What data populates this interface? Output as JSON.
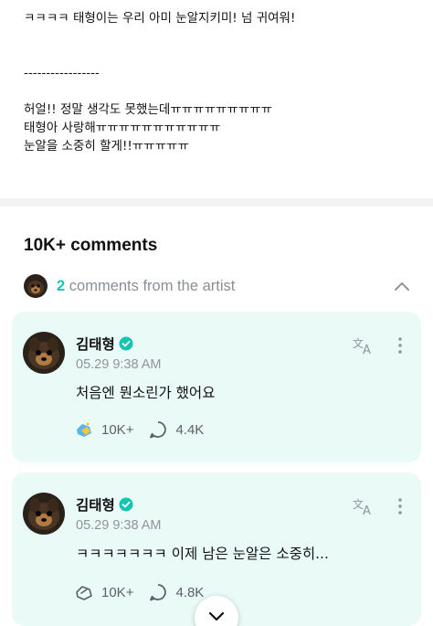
{
  "post": {
    "line1": "ㅋㅋㅋㅋ 태형이는 우리 아미 눈알지키미! 넘 귀여워!",
    "divider": "-----------------",
    "line2": "허얼!! 정말 생각도 못했는데ㅠㅠㅠㅠㅠㅠㅠㅠㅠ",
    "line3": "태형아 사랑해ㅠㅠㅠㅠㅠㅠㅠㅠㅠㅠㅠ",
    "line4": "눈알을 소중히 할게!!ㅠㅠㅠㅠㅠ"
  },
  "comments_header": {
    "count": "10K+ comments",
    "artist_count": "2",
    "artist_label": "comments from the artist"
  },
  "comments": [
    {
      "author": "김태형",
      "time": "05.29 9:38 AM",
      "text": "처음엔 뭔소린가 했어요",
      "likes": "10K+",
      "replies": "4.4K",
      "liked": true
    },
    {
      "author": "김태형",
      "time": "05.29 9:38 AM",
      "text": "ㅋㅋㅋㅋㅋㅋㅋ 이제 남은 눈알은 소중히...",
      "likes": "10K+",
      "replies": "4.8K",
      "liked": false
    }
  ],
  "colors": {
    "accent": "#17c3b2",
    "card_bg": "#e9faf7",
    "muted": "#8f959b"
  }
}
